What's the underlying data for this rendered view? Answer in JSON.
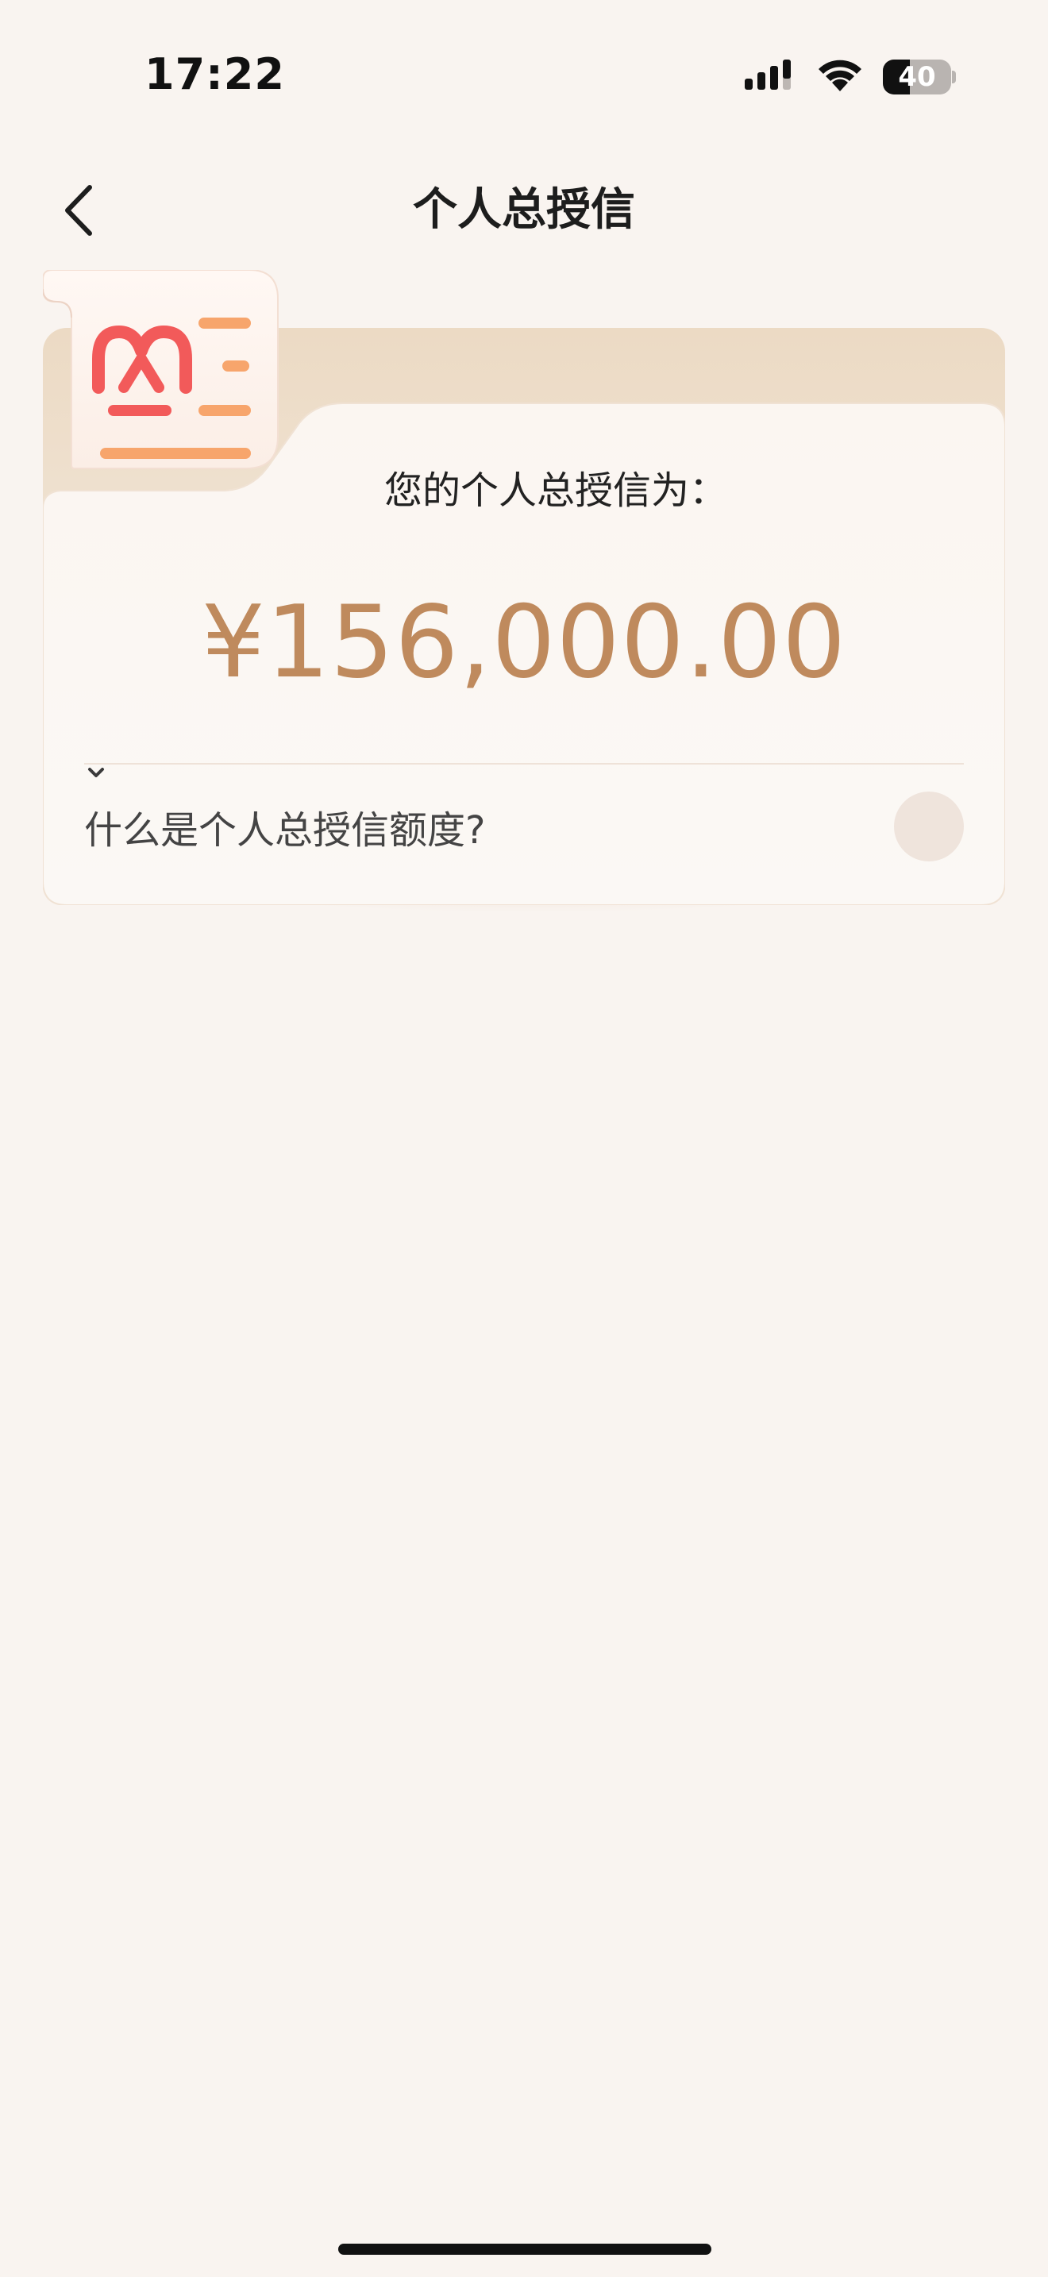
{
  "status_bar": {
    "time": "17:22",
    "battery_level": "40",
    "battery_fraction": 0.4,
    "signal_icon": "cellular-signal-icon",
    "wifi_icon": "wifi-icon",
    "battery_icon": "battery-icon"
  },
  "nav": {
    "back_icon": "chevron-left-icon",
    "title": "个人总授信"
  },
  "card": {
    "icon": "document-m-icon",
    "subtitle": "您的个人总授信为：",
    "amount": "¥156,000.00",
    "faq_label": "什么是个人总授信额度?",
    "faq_toggle_icon": "chevron-down-icon"
  },
  "colors": {
    "background": "#f9f4f0",
    "amount": "#bf8a5d",
    "icon_red": "#f25a5a",
    "icon_orange": "#f7a56c"
  }
}
